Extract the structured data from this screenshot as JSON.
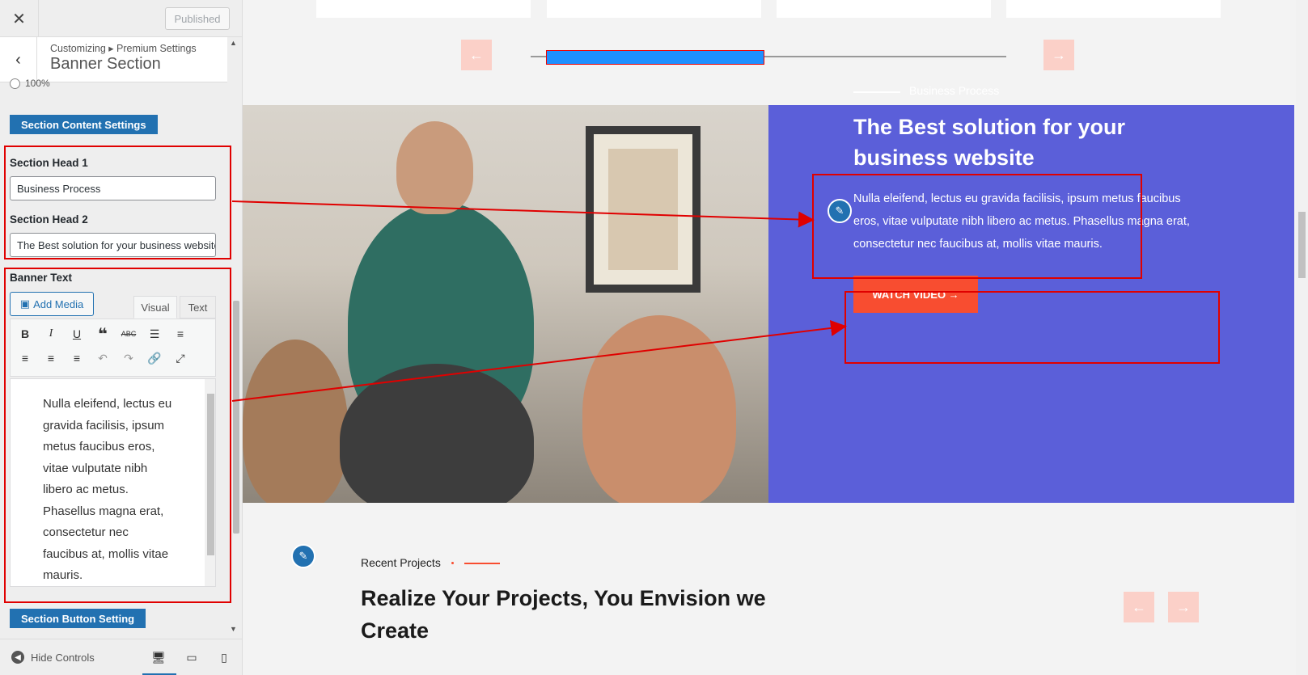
{
  "topbar": {
    "close_symbol": "✕",
    "publish_label": "Published"
  },
  "section_header": {
    "breadcrumb": "Customizing ▸ Premium Settings",
    "title": "Banner Section",
    "back_symbol": "‹"
  },
  "radio_option": "100%",
  "content_settings_label": "Section Content Settings",
  "head1": {
    "label": "Section Head 1",
    "value": "Business Process"
  },
  "head2": {
    "label": "Section Head 2",
    "value": "The Best solution for your business website"
  },
  "banner_text": {
    "label": "Banner Text",
    "add_media": "Add Media",
    "tab_visual": "Visual",
    "tab_text": "Text",
    "content": "Nulla eleifend, lectus eu gravida facilisis, ipsum metus faucibus eros, vitae vulputate nibh libero ac metus. Phasellus magna erat, consectetur nec faucibus at, mollis vitae mauris."
  },
  "button_setting_label": "Section Button Setting",
  "bottombar": {
    "hide_controls": "Hide Controls"
  },
  "banner": {
    "tag": "Business Process",
    "heading": "The Best solution for your business website",
    "paragraph": "Nulla eleifend, lectus eu gravida facilisis, ipsum metus faucibus eros, vitae vulputate nibh libero ac metus. Phasellus magna erat, consectetur nec faucibus at, mollis vitae mauris.",
    "button": "WATCH VIDEO →"
  },
  "recent": {
    "label": "Recent Projects",
    "heading": "Realize Your Projects, You Envision we Create"
  },
  "arrows": {
    "left": "←",
    "right": "→"
  },
  "colors": {
    "accent": "#2271b1",
    "banner_blue": "#5b5fd9",
    "orange": "#f84d30",
    "annotation_red": "#e00000"
  },
  "icons": [
    "close-icon",
    "back-icon",
    "bold-icon",
    "italic-icon",
    "underline-icon",
    "blockquote-icon",
    "strikethrough-icon",
    "bullet-list-icon",
    "numbered-list-icon",
    "align-left-icon",
    "align-center-icon",
    "align-right-icon",
    "undo-icon",
    "redo-icon",
    "link-icon",
    "fullscreen-icon",
    "edit-pencil-icon",
    "desktop-icon",
    "tablet-icon",
    "mobile-icon"
  ]
}
